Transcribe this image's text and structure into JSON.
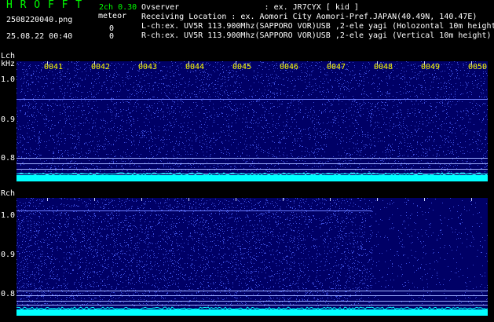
{
  "header": {
    "app_title": "H R O F F T",
    "channel_info": "2ch 0.30",
    "meteor_label": "meteor",
    "file_name": "2508220040.png",
    "timestamp": "25.08.22 00:40",
    "meteor_count_l": "0",
    "meteor_count_r": "0",
    "observer": "Ovserver                  : ex. JR7CYX [ kid ]",
    "location": "Receiving Location : ex. Aomori City Aomori-Pref.JAPAN(40.49N, 140.47E)",
    "lch_info": "L-ch:ex. UV5R 113.900Mhz(SAPPORO VOR)USB ,2-ele yagi (Holozontal 10m height",
    "rch_info": "R-ch:ex. UV5R 113.900Mhz(SAPPORO VOR)USB ,2-ele yagi (Vertical 10m height)"
  },
  "lch": {
    "name": "Lch",
    "unit": "kHz",
    "ticks": [
      "1.0",
      "0.9",
      "0.8"
    ]
  },
  "rch": {
    "name": "Rch",
    "ticks": [
      "1.0",
      "0.9",
      "0.8"
    ]
  },
  "time_labels": [
    "0041",
    "0042",
    "0043",
    "0044",
    "0045",
    "0046",
    "0047",
    "0048",
    "0049",
    "0050"
  ],
  "colors": {
    "panel_bg": "#000066",
    "noise": "#3b4bd8",
    "baseline": "#00ffff",
    "title_green": "#00ff00",
    "time_yellow": "#ffff00"
  }
}
